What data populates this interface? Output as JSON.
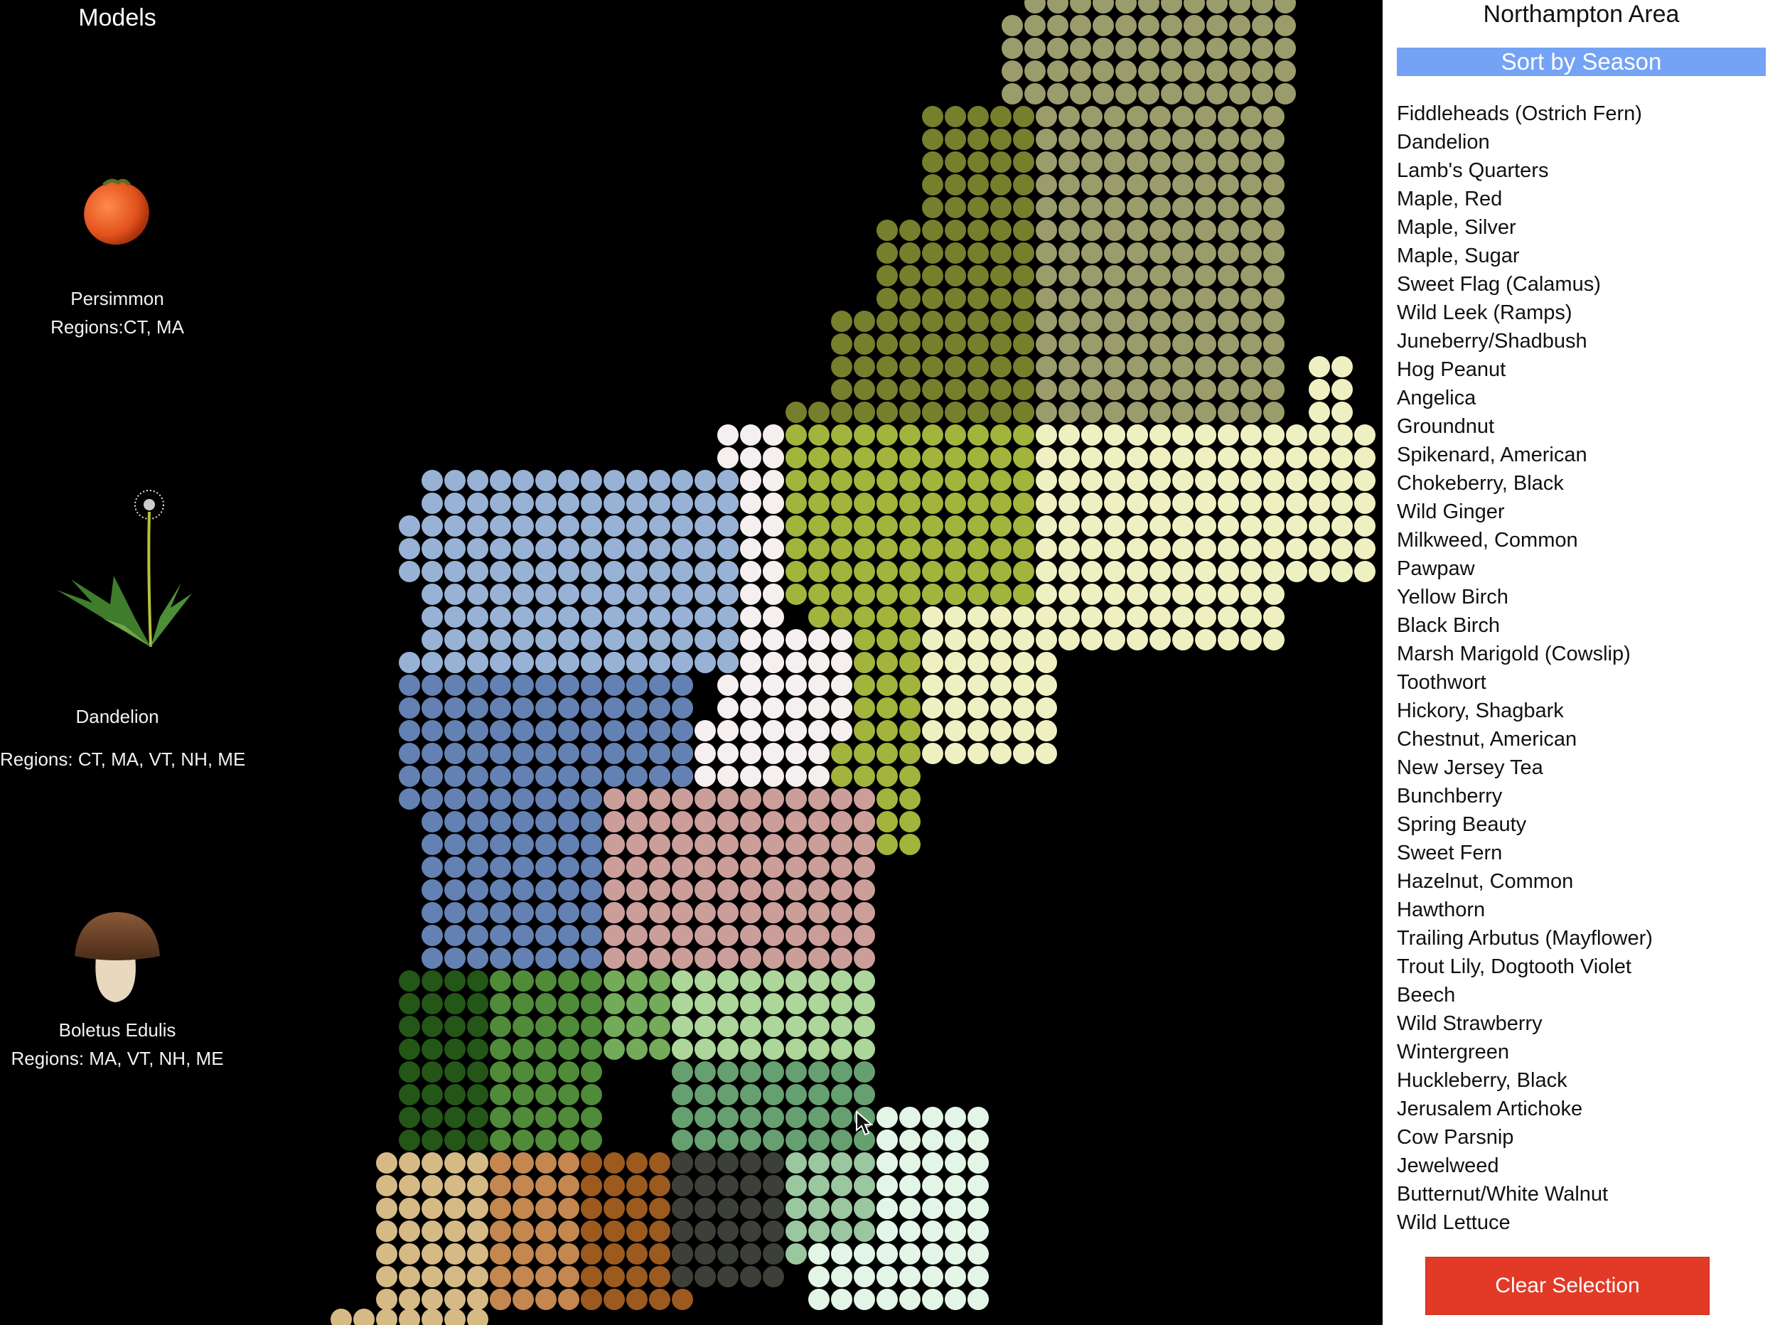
{
  "models": {
    "title": "Models",
    "items": [
      {
        "name": "Persimmon",
        "regions": "Regions:CT, MA",
        "icon": "persimmon-fruit-icon"
      },
      {
        "name": "Dandelion",
        "regions": "Regions: CT, MA, VT, NH, ME",
        "icon": "dandelion-plant-icon"
      },
      {
        "name": "Boletus Edulis",
        "regions": "Regions: MA, VT, NH, ME",
        "icon": "mushroom-icon"
      }
    ]
  },
  "sidebar": {
    "title": "Northampton Area",
    "sort_label": "Sort by Season",
    "clear_label": "Clear Selection",
    "species": [
      "Fiddleheads (Ostrich Fern)",
      "Dandelion",
      "Lamb's Quarters",
      "Maple, Red",
      "Maple, Silver",
      "Maple, Sugar",
      "Sweet Flag (Calamus)",
      "Wild Leek (Ramps)",
      "Juneberry/Shadbush",
      "Hog Peanut",
      "Angelica",
      "Groundnut",
      "Spikenard, American",
      "Chokeberry, Black",
      "Wild Ginger",
      "Milkweed, Common",
      "Pawpaw",
      "Yellow Birch",
      "Black Birch",
      "Marsh Marigold (Cowslip)",
      "Toothwort",
      "Hickory, Shagbark",
      "Chestnut, American",
      "New Jersey Tea",
      "Bunchberry",
      "Spring Beauty",
      "Sweet Fern",
      "Hazelnut, Common",
      "Hawthorn",
      "Trailing Arbutus (Mayflower)",
      "Trout Lily, Dogtooth Violet",
      "Beech",
      "Wild Strawberry",
      "Wintergreen",
      "Huckleberry, Black",
      "Jerusalem Artichoke",
      "Cow Parsnip",
      "Jewelweed",
      "Butternut/White Walnut",
      "Wild Lettuce"
    ]
  },
  "colors": {
    "sort_button": "#74a3f5",
    "clear_button": "#e23a27",
    "regions": [
      "#9a9c6c",
      "#767f2c",
      "#eef0c2",
      "#a2b43c",
      "#f5eff0",
      "#98b2d6",
      "#6481b3",
      "#cc9e9a",
      "#235617",
      "#4f8b38",
      "#74ab5a",
      "#acd69a",
      "#66a070",
      "#d6ba85",
      "#c3874f",
      "#9c5a1f",
      "#3c4039",
      "#9ac79f",
      "#e2f5e6"
    ]
  }
}
